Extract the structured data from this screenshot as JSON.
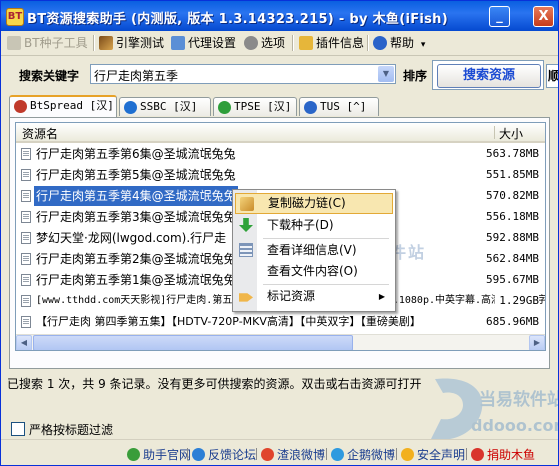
{
  "window": {
    "title": "BT资源搜索助手 (内测版, 版本 1.3.14323.215) - by 木鱼(iFish)",
    "min_glyph": "_",
    "close_glyph": "X"
  },
  "menu": [
    {
      "label": "BT种子工具",
      "icon": "bt-tool-icon",
      "disabled": true
    },
    {
      "label": "引擎测试",
      "icon": "engine-test-icon"
    },
    {
      "label": "代理设置",
      "icon": "proxy-settings-icon"
    },
    {
      "label": "选项",
      "icon": "options-icon"
    },
    {
      "label": "插件信息",
      "icon": "plugin-icon"
    },
    {
      "label": "帮助",
      "icon": "help-icon"
    }
  ],
  "search": {
    "keyword_label": "搜索关键字",
    "keyword_value": "行尸走肉第五季",
    "sort_label": "排序",
    "search_button": "搜索资源",
    "more_button": "顺"
  },
  "tabs": [
    {
      "label": "BtSpread [汉]",
      "icon_color": "#c0392b",
      "active": true
    },
    {
      "label": "SSBC [汉]",
      "icon_color": "#1f6fd1"
    },
    {
      "label": "TPSE [汉]",
      "icon_color": "#2e9e3a"
    },
    {
      "label": "TUS [^]",
      "icon_color": "#2b66c8"
    }
  ],
  "list": {
    "col_name": "资源名",
    "col_size": "大小",
    "rows": [
      {
        "name": "行尸走肉第五季第6集@圣城流氓兔兔",
        "size": "563.78MB"
      },
      {
        "name": "行尸走肉第五季第5集@圣城流氓兔兔",
        "size": "551.85MB"
      },
      {
        "name": "行尸走肉第五季第4集@圣城流氓兔兔",
        "size": "570.82MB",
        "selected": true
      },
      {
        "name": "行尸走肉第五季第3集@圣城流氓兔兔",
        "size": "556.18MB"
      },
      {
        "name": "梦幻天堂·龙网(lwgod.com).行尸走",
        "size": "592.88MB"
      },
      {
        "name": "行尸走肉第五季第2集@圣城流氓兔兔",
        "size": "562.84MB"
      },
      {
        "name": "行尸走肉第五季第1集@圣城流氓兔兔",
        "size": "595.67MB"
      },
      {
        "name": "[www.tthdd.com天天影视]行尸走肉.第五季.The.Walking.Dead.S05.E01.1080p.中英字幕.高清-中英双字.MKV",
        "size": "1.29GB"
      },
      {
        "name": "【行尸走肉 第四季第五集】【HDTV-720P-MKV高清】【中英双字】【重磅美剧】",
        "size": "685.96MB"
      }
    ]
  },
  "context_menu": [
    {
      "label": "复制磁力链(C)",
      "icon": "copy-icon",
      "highlight": true
    },
    {
      "label": "下载种子(D)",
      "icon": "download-icon"
    },
    {
      "label": "查看详细信息(V)",
      "icon": "details-icon"
    },
    {
      "label": "查看文件内容(O)",
      "icon": "file-content-icon"
    },
    {
      "label": "标记资源",
      "icon": "tag-icon",
      "submenu": true
    }
  ],
  "status": "已搜索 1 次，共 9 条记录。没有更多可供搜索的资源。双击或右击资源可打开",
  "filter_checkbox": "严格按标题过滤",
  "footer": [
    {
      "label": "助手官网",
      "icon_color": "#3a9d3a"
    },
    {
      "label": "反馈论坛",
      "icon_color": "#2c7fd6"
    },
    {
      "label": "渣浪微博",
      "icon_color": "#e0452c"
    },
    {
      "label": "企鹅微博",
      "icon_color": "#2f9adf"
    },
    {
      "label": "安全声明",
      "icon_color": "#f2b01e"
    },
    {
      "label": "捐助木鱼",
      "icon_color": "#d9342b",
      "red": true
    }
  ],
  "watermark": {
    "brand": "当易软件站",
    "domain": "ddooo.com",
    "ghost": "当易软件站"
  },
  "colors": {
    "title_bar": "#0a5fe0",
    "selection": "#316ac5",
    "menu_highlight": "#f8e7b0"
  }
}
